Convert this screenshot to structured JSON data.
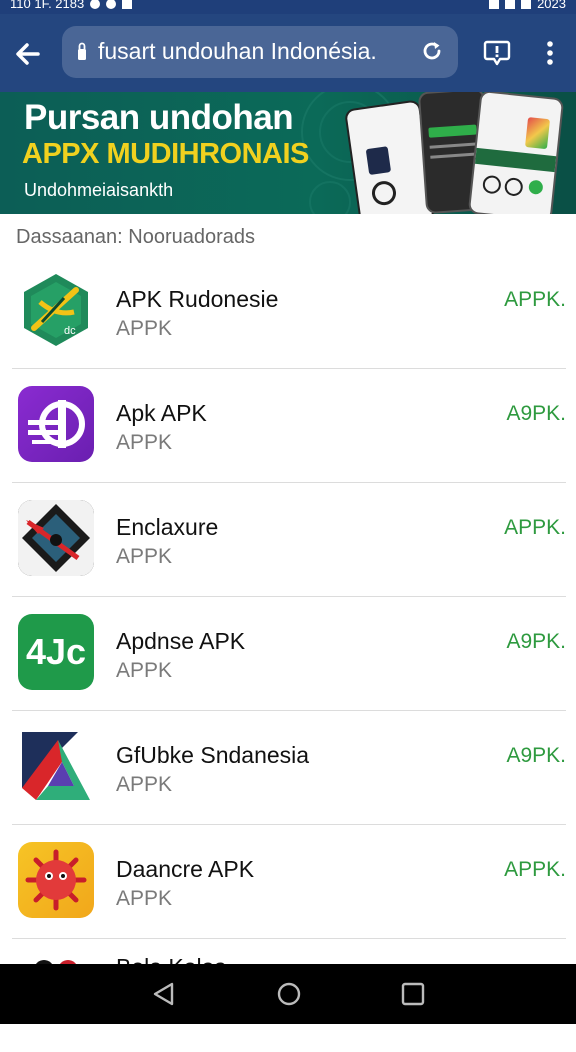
{
  "status_bar": {
    "left_text": "110 1F. 2183",
    "right_text": "2023"
  },
  "browser": {
    "url": "fusart undouhan Indonésia."
  },
  "banner": {
    "title": "Pursan undohan",
    "subtitle": "APPX MUDIHRONAIS",
    "small_text": "Undohmeiaisankth"
  },
  "section_label": "Dassaanan: Nooruadorads",
  "apps": [
    {
      "name": "APK Rudonesie",
      "sub": "APPK",
      "action": "APPK.",
      "icon": "crossbow-app-icon"
    },
    {
      "name": "Apk APK",
      "sub": "APPK",
      "action": "A9PK.",
      "icon": "purple-cross-app-icon"
    },
    {
      "name": "Enclaxure",
      "sub": "APPK",
      "action": "APPK.",
      "icon": "compass-app-icon"
    },
    {
      "name": "Apdnse APK",
      "sub": "APPK",
      "action": "A9PK.",
      "icon": "4jc-app-icon",
      "icon_text": "4Jc"
    },
    {
      "name": "GfUbke Sndanesia",
      "sub": "APPK",
      "action": "A9PK.",
      "icon": "triangle-app-icon"
    },
    {
      "name": "Daancre APK",
      "sub": "APPK",
      "action": "APPK.",
      "icon": "red-virus-app-icon"
    },
    {
      "name": "Bela Kalas",
      "sub": "",
      "action": "",
      "icon": "partial-app-icon"
    }
  ],
  "colors": {
    "toolbar": "#24467f",
    "banner": "#0b6a58",
    "accent_yellow": "#f1d11f",
    "action_green": "#2e9a3f"
  }
}
